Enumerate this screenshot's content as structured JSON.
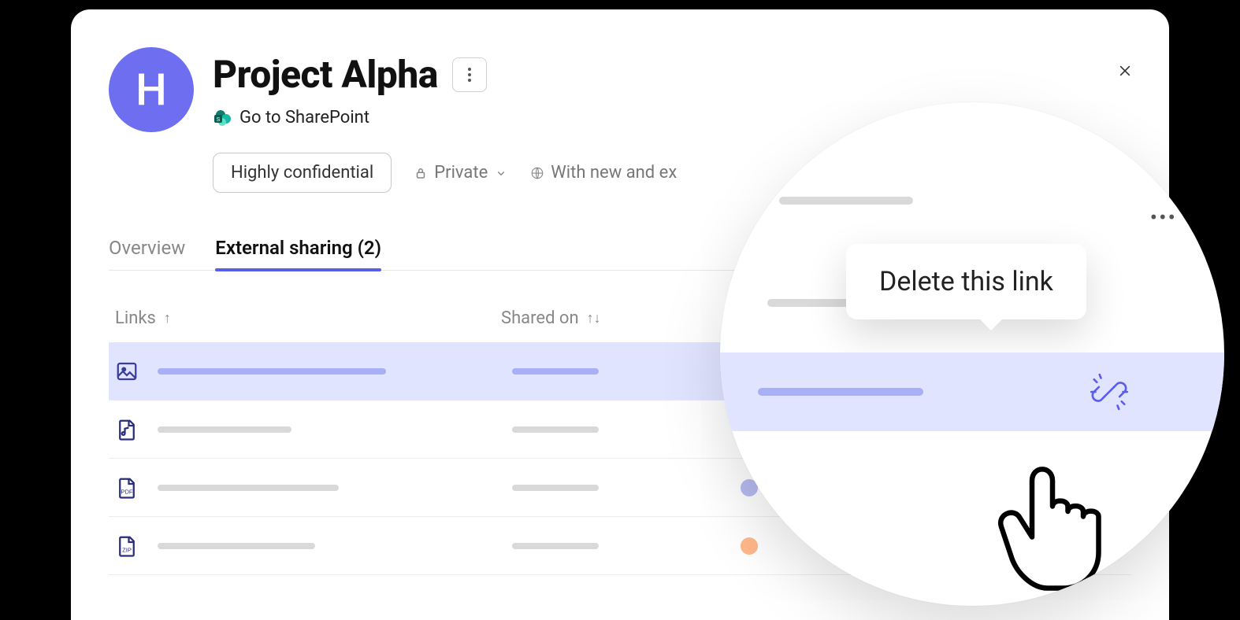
{
  "avatar_letter": "H",
  "page_title": "Project Alpha",
  "sharepoint_link_label": "Go to SharePoint",
  "confidentiality_badge": "Highly confidential",
  "privacy_label": "Private",
  "sharing_scope_label": "With new and ex",
  "tabs": {
    "overview": "Overview",
    "external_sharing": "External sharing (2)"
  },
  "columns": {
    "links": "Links",
    "shared_on": "Shared on"
  },
  "tooltip_text": "Delete this link",
  "row_icons": [
    "image",
    "music",
    "pdf",
    "zip"
  ]
}
